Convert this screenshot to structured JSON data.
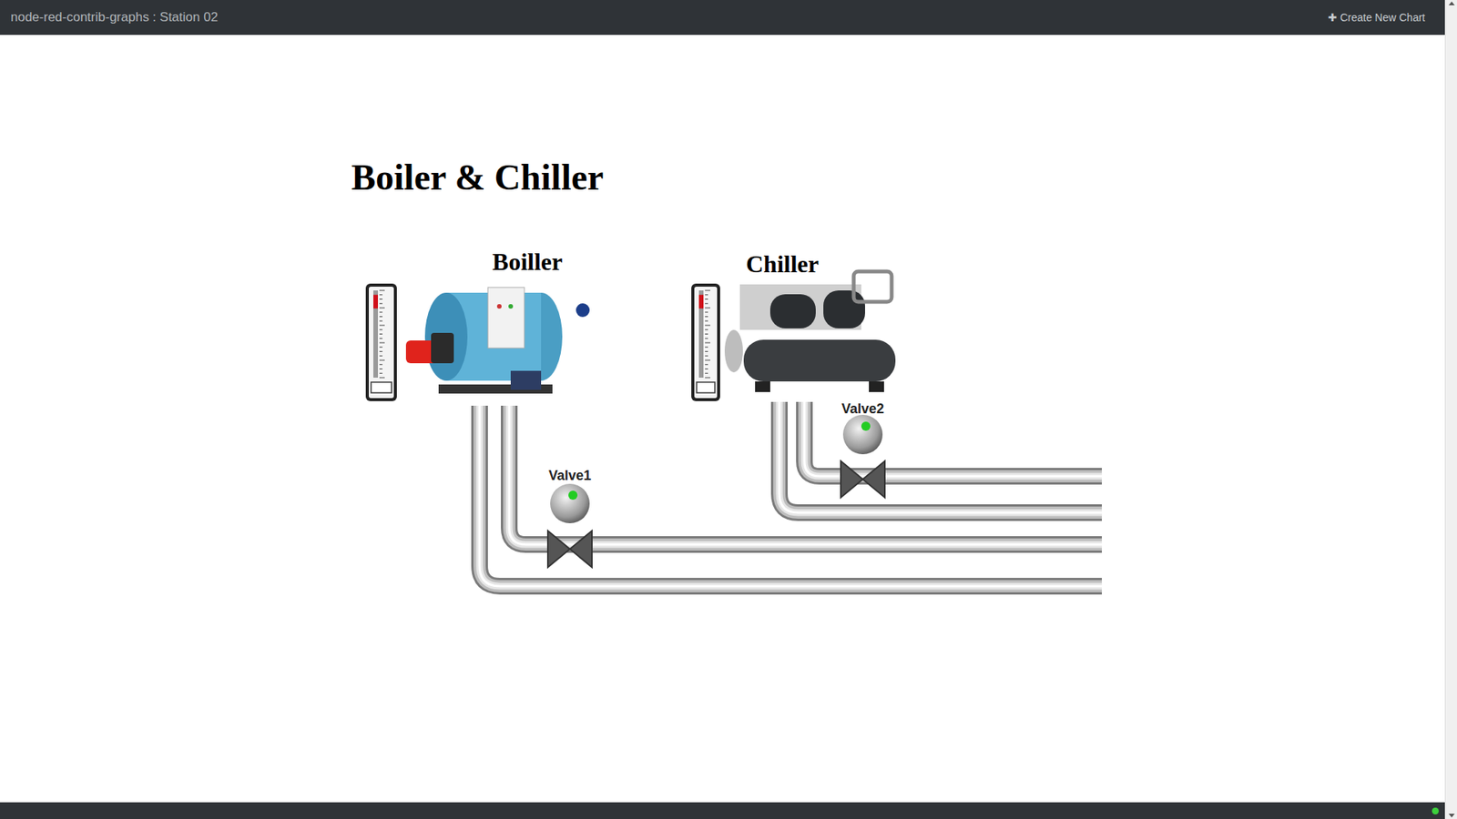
{
  "header": {
    "title": "node-red-contrib-graphs : Station 02",
    "action_icon": "✚",
    "action": "Create New Chart"
  },
  "page": {
    "title": "Boiler & Chiller"
  },
  "equipment": [
    {
      "name": "Boiller",
      "kind": "boiler",
      "gauge": {
        "level": 0.95
      }
    },
    {
      "name": "Chiller",
      "kind": "chiller",
      "gauge": {
        "level": 0.95
      }
    }
  ],
  "valves": [
    {
      "label": "Valve1",
      "open": true,
      "color": "#22cc22"
    },
    {
      "label": "Valve2",
      "open": true,
      "color": "#22cc22"
    }
  ],
  "status_bar": {
    "connected": true
  }
}
